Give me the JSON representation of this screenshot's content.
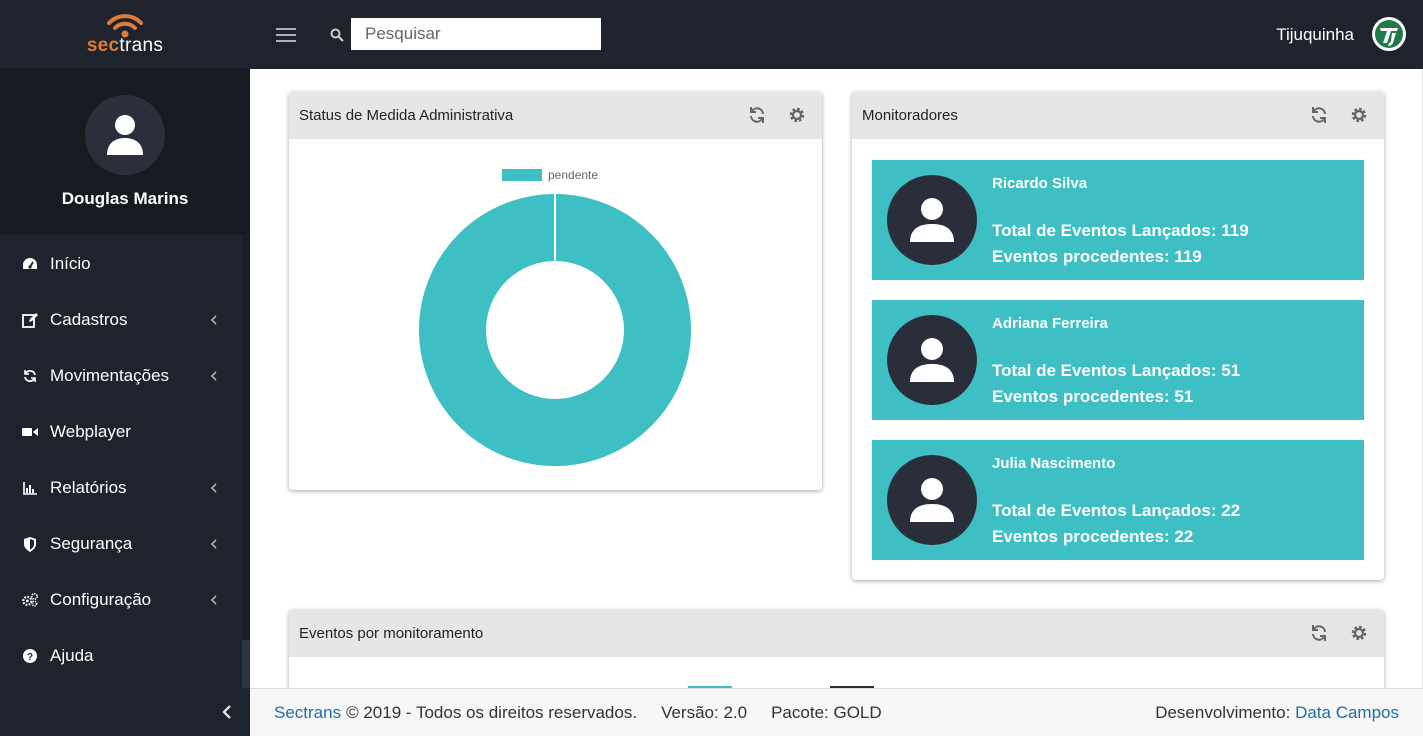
{
  "brand": {
    "part1": "sec",
    "part2": "trans"
  },
  "profile": {
    "name": "Douglas Marins"
  },
  "menu": [
    {
      "label": "Início",
      "icon": "dashboard-icon",
      "has_submenu": false
    },
    {
      "label": "Cadastros",
      "icon": "edit-icon",
      "has_submenu": true
    },
    {
      "label": "Movimentações",
      "icon": "refresh-icon",
      "has_submenu": true
    },
    {
      "label": "Webplayer",
      "icon": "video-camera-icon",
      "has_submenu": false
    },
    {
      "label": "Relatórios",
      "icon": "bar-chart-icon",
      "has_submenu": true
    },
    {
      "label": "Segurança",
      "icon": "shield-icon",
      "has_submenu": true
    },
    {
      "label": "Configuração",
      "icon": "cogs-icon",
      "has_submenu": true
    },
    {
      "label": "Ajuda",
      "icon": "question-circle-icon",
      "has_submenu": false
    }
  ],
  "topbar": {
    "search_placeholder": "Pesquisar",
    "user_name": "Tijuquinha"
  },
  "cards": {
    "status": {
      "title": "Status de Medida Administrativa",
      "chart_data": {
        "type": "pie",
        "categories": [
          "pendente"
        ],
        "values": [
          1
        ],
        "legend": "top",
        "colors": [
          "#3ebfc3"
        ]
      }
    },
    "monitoradores": {
      "title": "Monitoradores",
      "items": [
        {
          "name": "Ricardo Silva",
          "total": "Total de Eventos Lançados: 119",
          "procedentes": "Eventos procedentes: 119"
        },
        {
          "name": "Adriana Ferreira",
          "total": "Total de Eventos Lançados: 51",
          "procedentes": "Eventos procedentes: 51"
        },
        {
          "name": "Julia Nascimento",
          "total": "Total de Eventos Lançados: 22",
          "procedentes": "Eventos procedentes: 22"
        }
      ]
    },
    "eventos": {
      "title": "Eventos por monitoramento"
    }
  },
  "footer": {
    "brand_link": "Sectrans",
    "copyright": "© 2019 - Todos os direitos reservados.",
    "version": "Versão: 2.0",
    "package": "Pacote: GOLD",
    "dev_label": "Desenvolvimento:",
    "dev_link": "Data Campos"
  },
  "colors": {
    "sidebar": "#1f232d",
    "accent_teal": "#3ebfc3",
    "brand_orange": "#e07b39",
    "link": "#1d6fa5"
  }
}
